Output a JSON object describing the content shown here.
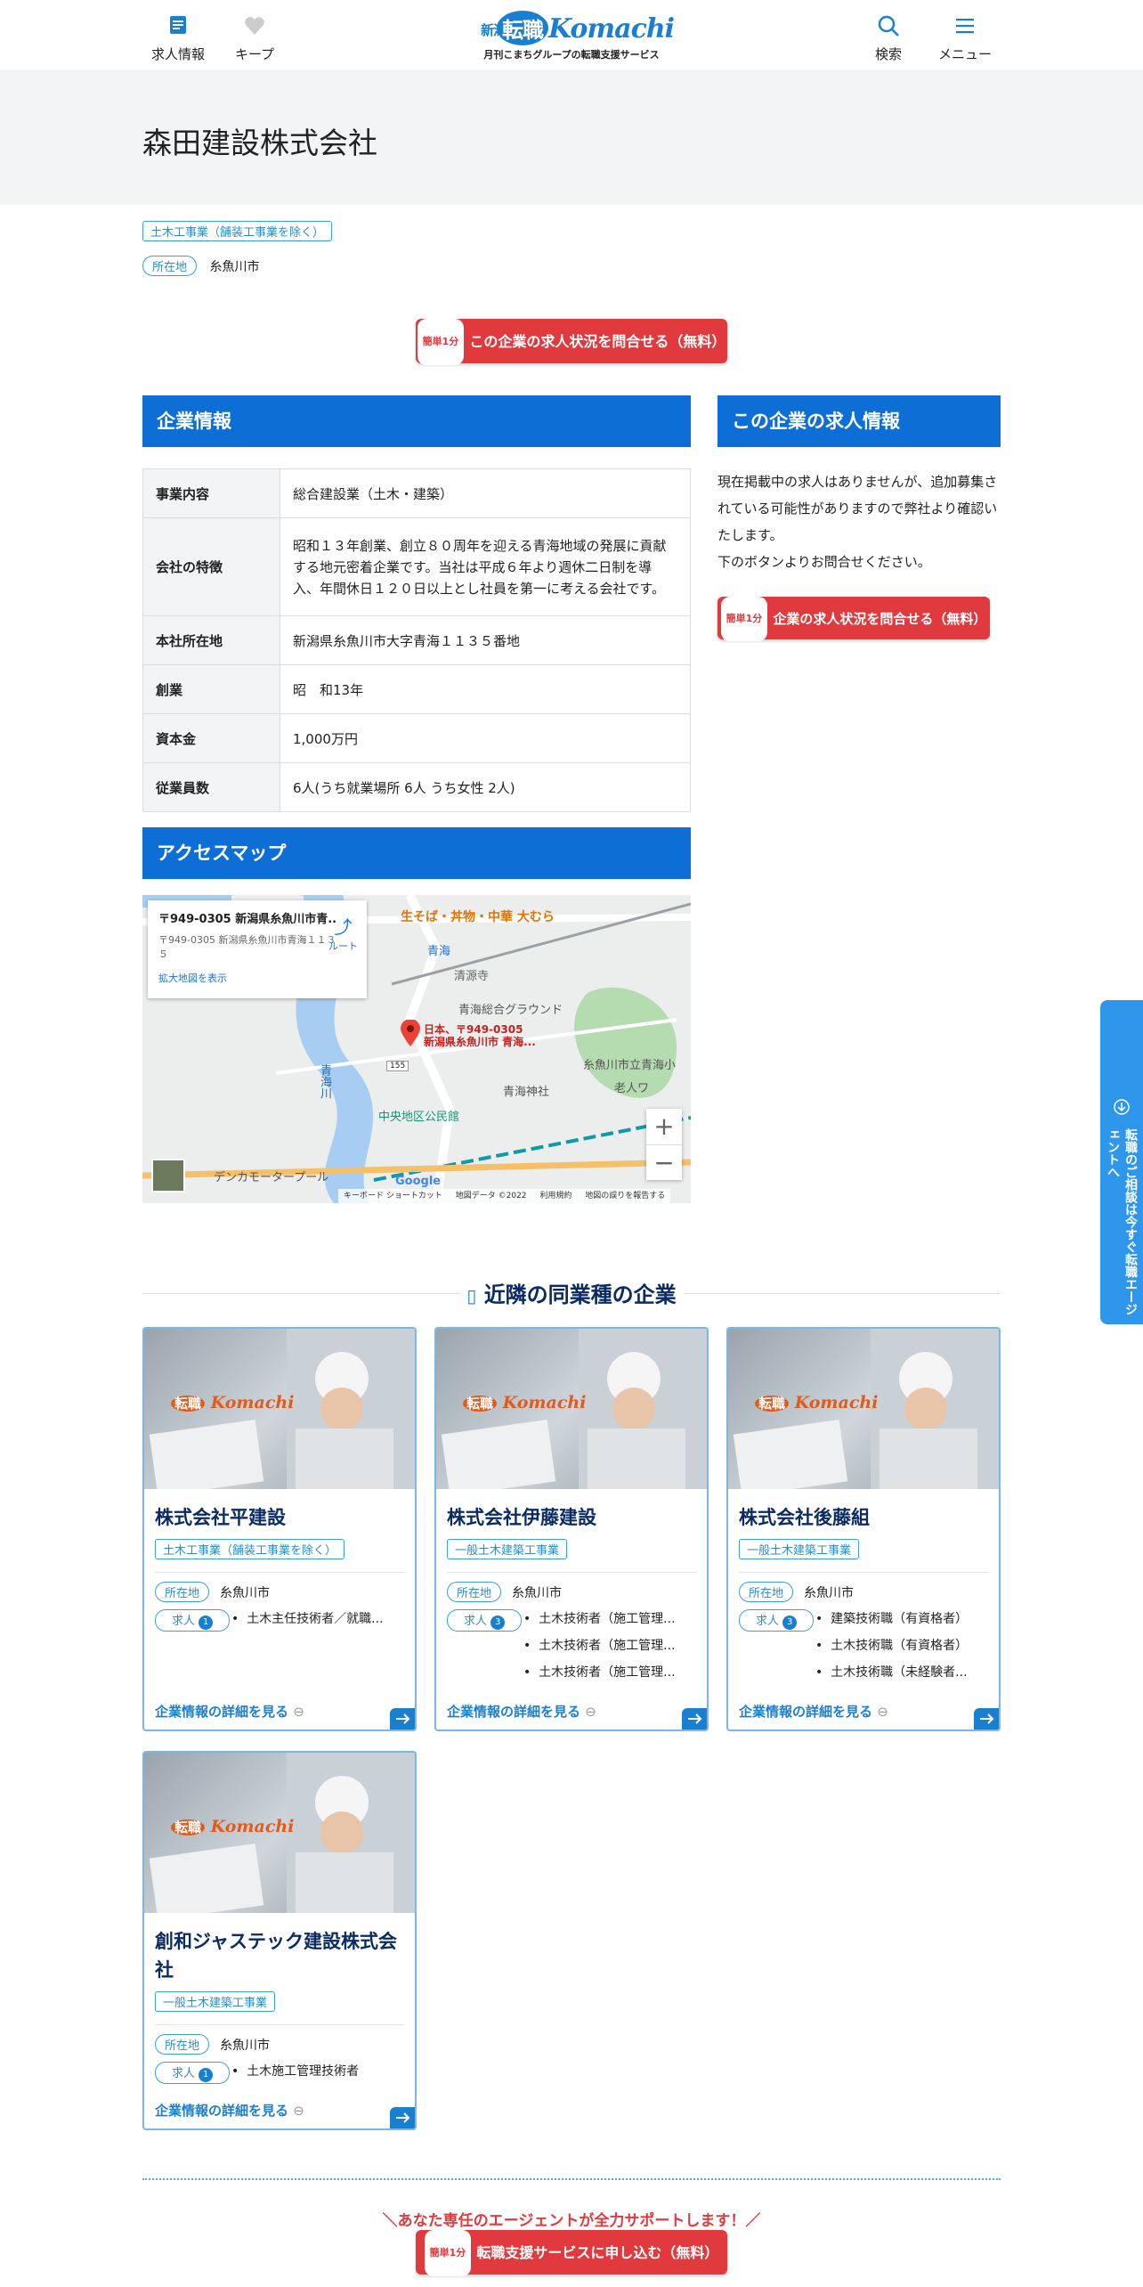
{
  "header": {
    "job_info": "求人情報",
    "keep": "キープ",
    "search": "検索",
    "menu": "メニュー",
    "logo_niigata": "新潟",
    "logo_ten": "転職",
    "logo_komachi": "Komachi",
    "logo_sub": "月刊こまちグループの転職支援サービス"
  },
  "company": {
    "name": "森田建設株式会社",
    "industry_tag": "土木工事業（舗装工事業を除く）",
    "location_label": "所在地",
    "location": "糸魚川市"
  },
  "cta": {
    "badge": "簡単1分",
    "inquiry": "この企業の求人状況を問合せる（無料）"
  },
  "company_info": {
    "heading": "企業情報",
    "rows": [
      {
        "k": "事業内容",
        "v": "総合建設業（土木・建築）"
      },
      {
        "k": "会社の特徴",
        "v": "昭和１３年創業、創立８０周年を迎える青海地域の発展に貢献する地元密着企業です。当社は平成６年より週休二日制を導入、年間休日１２０日以上とし社員を第一に考える会社です。"
      },
      {
        "k": "本社所在地",
        "v": "新潟県糸魚川市大字青海１１３５番地"
      },
      {
        "k": "創業",
        "v": "昭　和13年"
      },
      {
        "k": "資本金",
        "v": "1,000万円"
      },
      {
        "k": "従業員数",
        "v": "6人(うち就業場所 6人 うち女性 2人)"
      }
    ]
  },
  "jobs": {
    "heading": "この企業の求人情報",
    "message": "現在掲載中の求人はありませんが、追加募集されている可能性がありますので弊社より確認いたします。\n下のボタンよりお問合せください。",
    "button_badge": "簡単1分",
    "button": "企業の求人状況を問合せる（無料）"
  },
  "access": {
    "heading": "アクセスマップ",
    "map": {
      "addr_title": "〒949-0305 新潟県糸魚川市青...",
      "addr_sub": "〒949-0305 新潟県糸魚川市青海１１３５",
      "enlarge": "拡大地図を表示",
      "route": "ルート",
      "pin_label1": "日本、〒949-0305",
      "pin_label2": "新潟県糸魚川市 青海...",
      "poi1": "生そば・丼物・中華 大むら",
      "poi2": "青海",
      "poi3": "清源寺",
      "poi4": "青海総合グラウンド",
      "poi5": "糸魚川市立青海小",
      "poi6": "老人ワ",
      "poi7": "青海神社",
      "poi8": "中央地区公民館",
      "poi9": "デンカモータープール",
      "river": "青海川",
      "road": "155",
      "google": "Google",
      "footer1": "キーボード ショートカット",
      "footer2": "地図データ ©2022",
      "footer3": "利用規約",
      "footer4": "地図の誤りを報告する"
    }
  },
  "nearby": {
    "heading": "近隣の同業種の企業",
    "location_label": "所在地",
    "jobs_label": "求人",
    "more": "企業情報の詳細を見る",
    "companies": [
      {
        "name": "株式会社平建設",
        "tag": "土木工事業（舗装工事業を除く）",
        "location": "糸魚川市",
        "count": "1",
        "jobs": [
          "土木主任技術者／就職..."
        ]
      },
      {
        "name": "株式会社伊藤建設",
        "tag": "一般土木建築工事業",
        "location": "糸魚川市",
        "count": "3",
        "jobs": [
          "土木技術者（施工管理...",
          "土木技術者（施工管理...",
          "土木技術者（施工管理..."
        ]
      },
      {
        "name": "株式会社後藤組",
        "tag": "一般土木建築工事業",
        "location": "糸魚川市",
        "count": "3",
        "jobs": [
          "建築技術職（有資格者）",
          "土木技術職（有資格者）",
          "土木技術職（未経験者..."
        ]
      },
      {
        "name": "創和ジャステック建設株式会社",
        "tag": "一般土木建築工事業",
        "location": "糸魚川市",
        "count": "1",
        "jobs": [
          "土木施工管理技術者"
        ]
      }
    ]
  },
  "side": {
    "text": "転職のご相談は今すぐ転職エージェントへ"
  },
  "bottom": {
    "partial": "＼あなた専任のエージェントが全力サポートします！／",
    "badge": "簡単1分",
    "button": "転職支援サービスに申し込む（無料）"
  },
  "colors": {
    "primary": "#0d6fd6",
    "accent": "#e03a3e"
  }
}
